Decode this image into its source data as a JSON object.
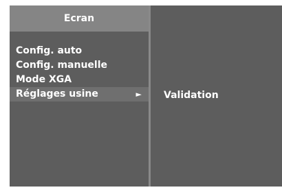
{
  "menu": {
    "title": "Ecran",
    "items": [
      {
        "label": "Config. auto"
      },
      {
        "label": "Config. manuelle"
      },
      {
        "label": "Mode XGA"
      },
      {
        "label": "Réglages usine",
        "arrow": "►"
      }
    ],
    "selected_index": 3
  },
  "submenu": {
    "items": [
      {
        "label": "Validation"
      }
    ]
  },
  "colors": {
    "panel": "#5d5d5d",
    "header": "#858585",
    "selected": "#6f6f6f",
    "text": "#ffffff"
  },
  "icons": {
    "submenu_arrow": "right-triangle-icon"
  }
}
